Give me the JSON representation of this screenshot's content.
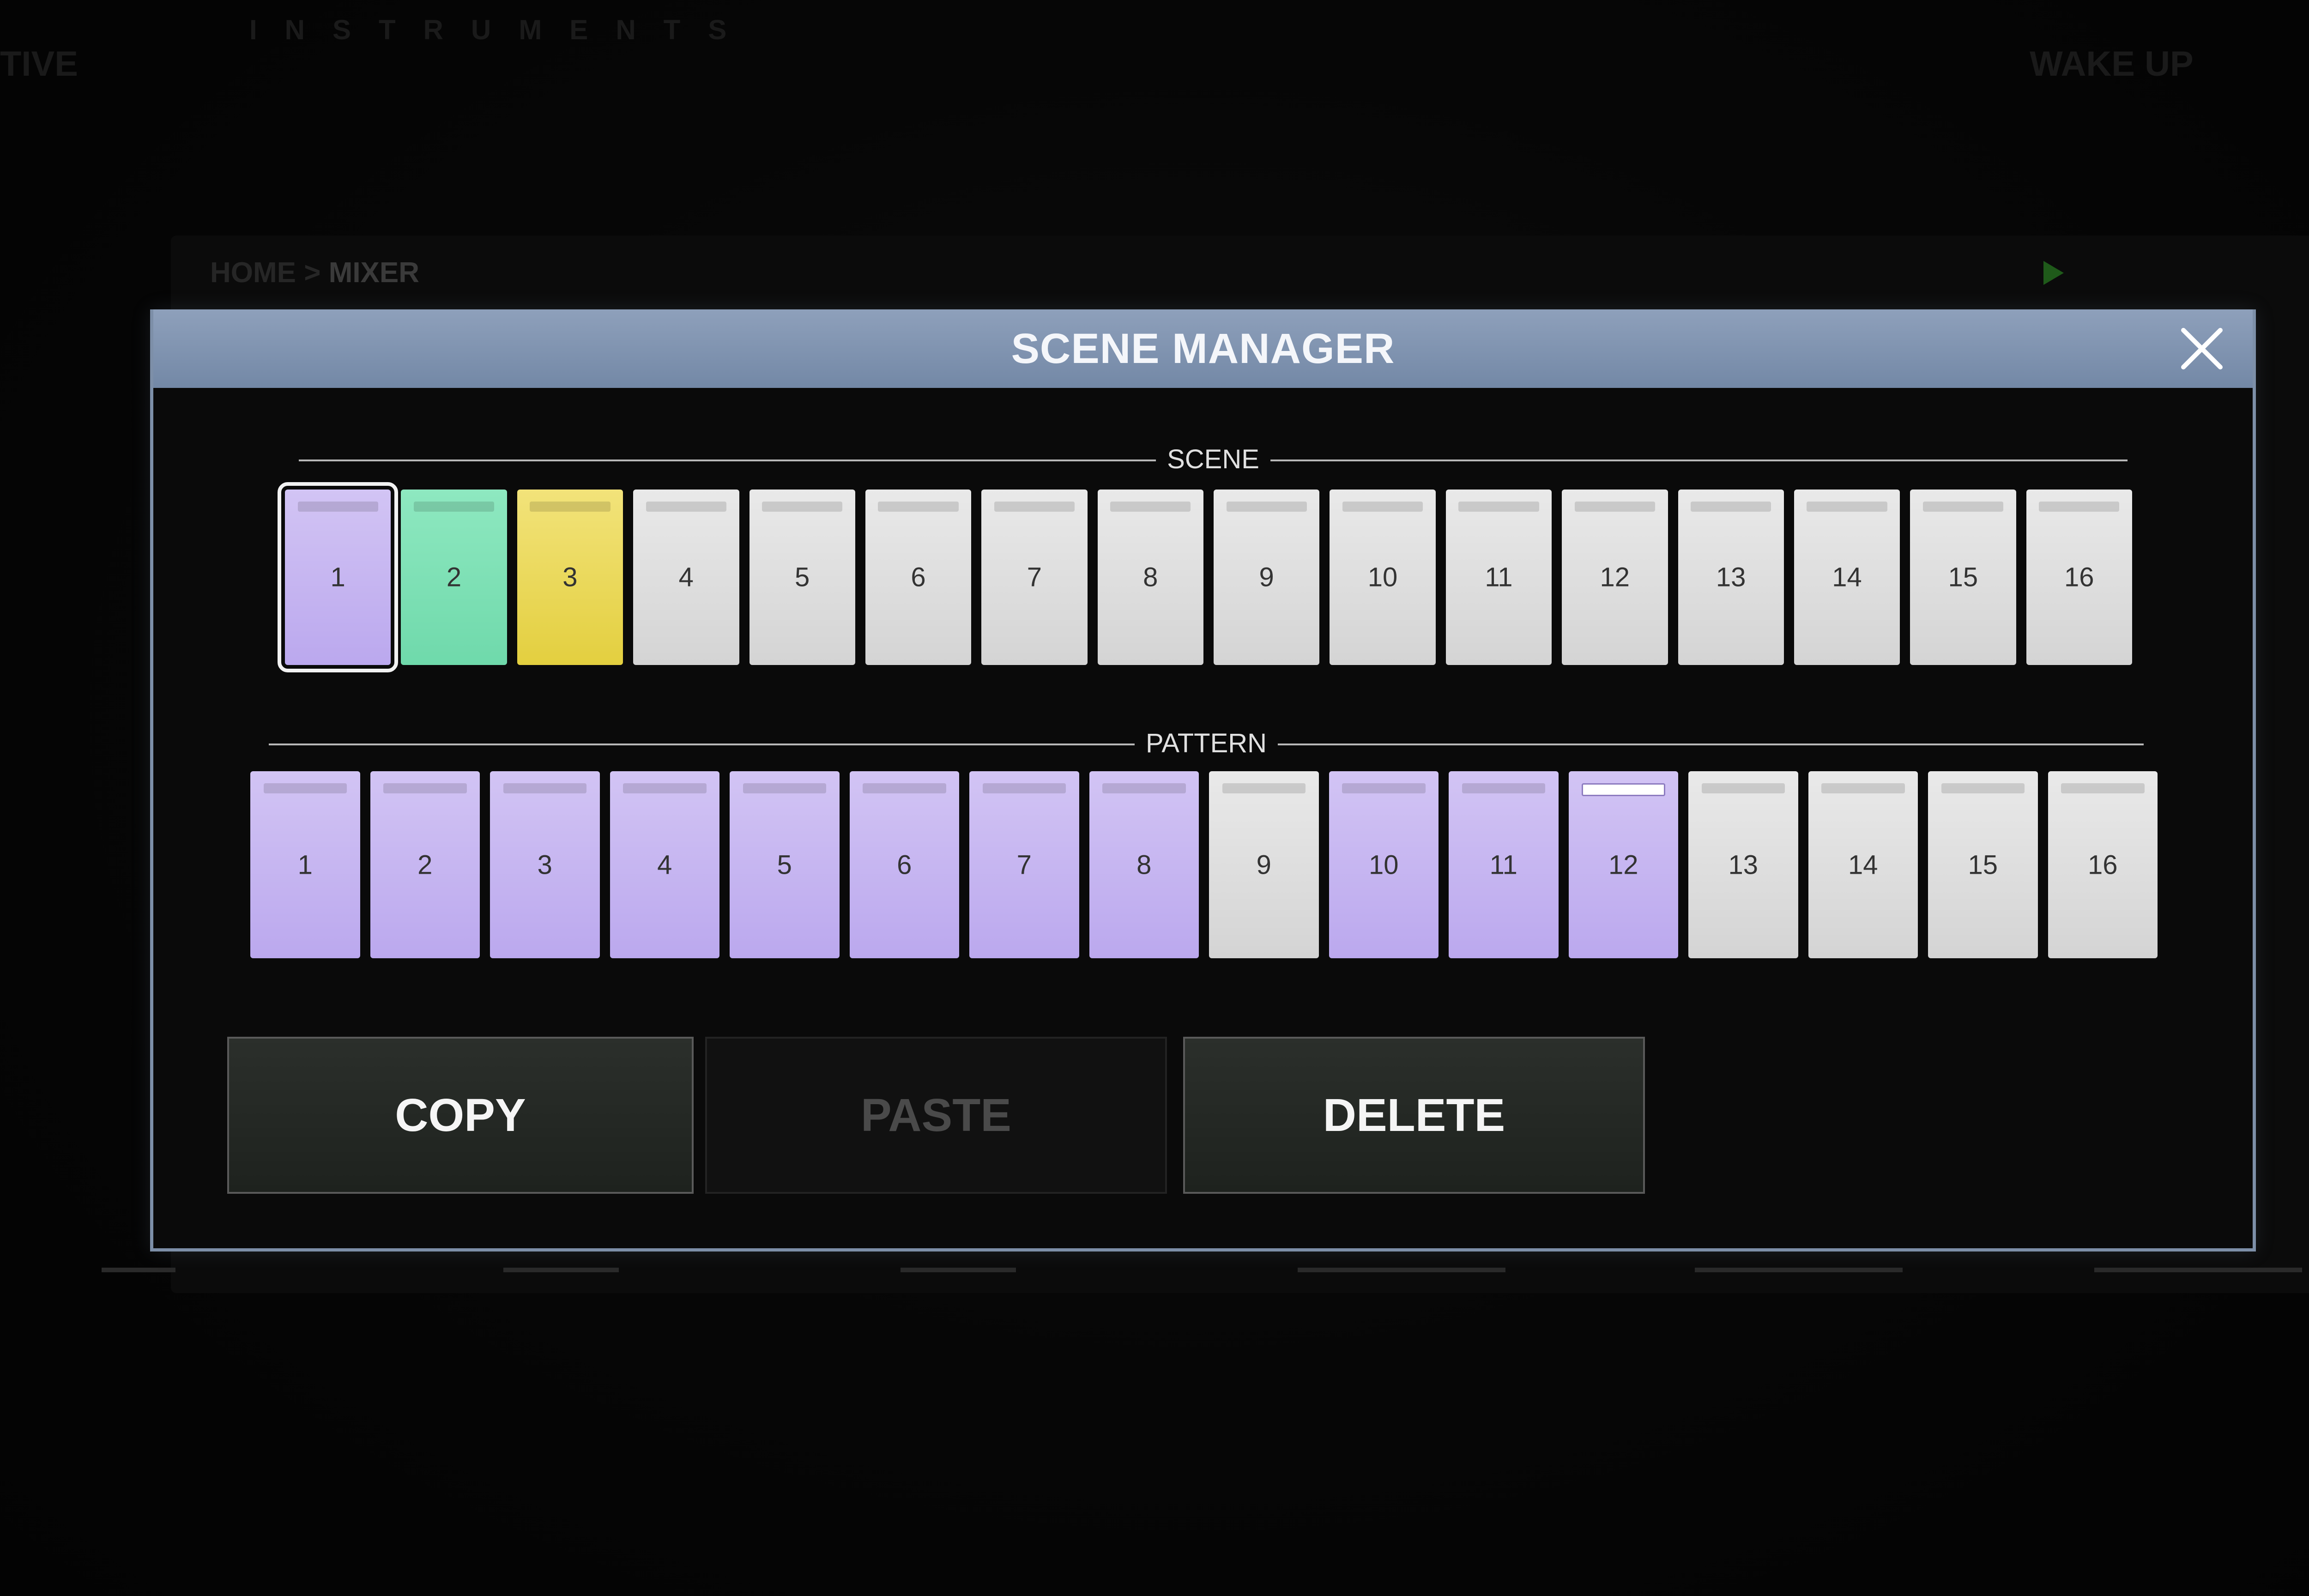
{
  "background": {
    "top_left_label": "TIVE",
    "top_middle_label": "INSTRUMENTS",
    "top_right_label": "WAKE UP",
    "breadcrumb_home": "HOME",
    "breadcrumb_separator": ">",
    "breadcrumb_current": "MIXER"
  },
  "dialog": {
    "title": "SCENE MANAGER",
    "close_icon": "close-icon"
  },
  "scene": {
    "label": "SCENE",
    "pads": [
      {
        "label": "1",
        "state": "purple",
        "selected": true
      },
      {
        "label": "2",
        "state": "green"
      },
      {
        "label": "3",
        "state": "yellow"
      },
      {
        "label": "4",
        "state": "empty"
      },
      {
        "label": "5",
        "state": "empty"
      },
      {
        "label": "6",
        "state": "empty"
      },
      {
        "label": "7",
        "state": "empty"
      },
      {
        "label": "8",
        "state": "empty"
      },
      {
        "label": "9",
        "state": "empty"
      },
      {
        "label": "10",
        "state": "empty"
      },
      {
        "label": "11",
        "state": "empty"
      },
      {
        "label": "12",
        "state": "empty"
      },
      {
        "label": "13",
        "state": "empty"
      },
      {
        "label": "14",
        "state": "empty"
      },
      {
        "label": "15",
        "state": "empty"
      },
      {
        "label": "16",
        "state": "empty"
      }
    ]
  },
  "pattern": {
    "label": "PATTERN",
    "pads": [
      {
        "label": "1",
        "state": "purple"
      },
      {
        "label": "2",
        "state": "purple"
      },
      {
        "label": "3",
        "state": "purple"
      },
      {
        "label": "4",
        "state": "purple"
      },
      {
        "label": "5",
        "state": "purple"
      },
      {
        "label": "6",
        "state": "purple"
      },
      {
        "label": "7",
        "state": "purple"
      },
      {
        "label": "8",
        "state": "purple"
      },
      {
        "label": "9",
        "state": "empty"
      },
      {
        "label": "10",
        "state": "purple"
      },
      {
        "label": "11",
        "state": "purple"
      },
      {
        "label": "12",
        "state": "purple",
        "current": true
      },
      {
        "label": "13",
        "state": "empty"
      },
      {
        "label": "14",
        "state": "empty"
      },
      {
        "label": "15",
        "state": "empty"
      },
      {
        "label": "16",
        "state": "empty"
      }
    ]
  },
  "actions": {
    "copy_label": "COPY",
    "paste_label": "PASTE",
    "paste_enabled": false,
    "delete_label": "DELETE"
  },
  "colors": {
    "header": "#7d8fa8",
    "pad_purple": "#c9b9f3",
    "pad_green": "#7fe2b6",
    "pad_yellow": "#ead95a",
    "pad_empty": "#dedede"
  }
}
